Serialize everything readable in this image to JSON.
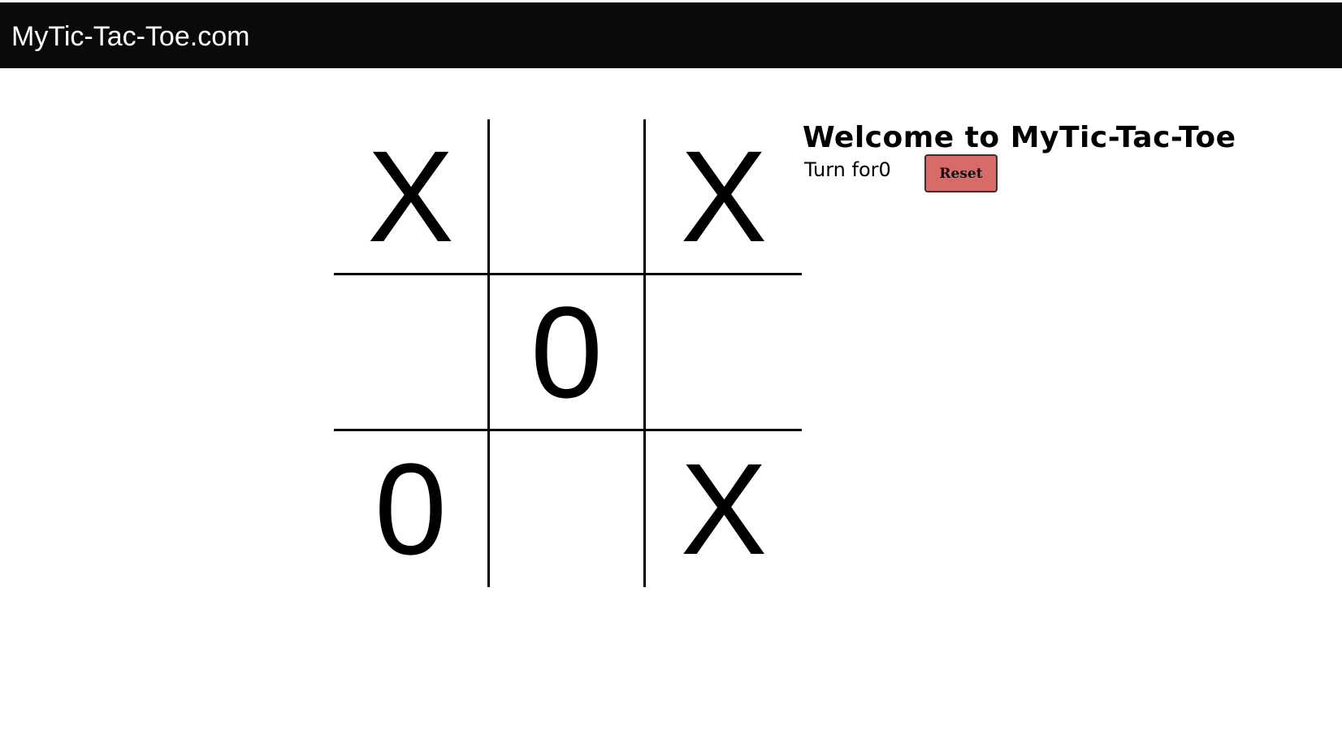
{
  "header": {
    "brand": "MyTic-Tac-Toe.com"
  },
  "board": {
    "cells": [
      [
        "X",
        "",
        "X"
      ],
      [
        "",
        "0",
        ""
      ],
      [
        "0",
        "",
        "X"
      ]
    ]
  },
  "panel": {
    "welcome": "Welcome to MyTic-Tac-Toe",
    "turn_text": "Turn for0",
    "reset_label": "Reset"
  },
  "colors": {
    "navbar_bg": "#0a0a0a",
    "reset_bg": "#d96a6a"
  }
}
